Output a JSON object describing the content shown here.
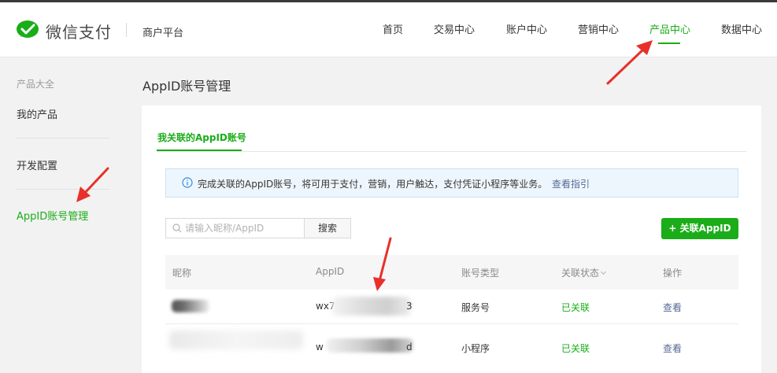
{
  "header": {
    "brand": "微信支付",
    "platform": "商户平台",
    "nav": [
      {
        "label": "首页",
        "active": false
      },
      {
        "label": "交易中心",
        "active": false
      },
      {
        "label": "账户中心",
        "active": false
      },
      {
        "label": "营销中心",
        "active": false
      },
      {
        "label": "产品中心",
        "active": true
      },
      {
        "label": "数据中心",
        "active": false
      }
    ]
  },
  "sidebar": {
    "title": "产品大全",
    "items": [
      {
        "label": "我的产品",
        "active": false
      },
      {
        "label": "开发配置",
        "active": false
      },
      {
        "label": "AppID账号管理",
        "active": true
      }
    ]
  },
  "page": {
    "title": "AppID账号管理",
    "tab": "我关联的AppID账号",
    "notice": {
      "icon": "info-icon",
      "text": "完成关联的AppID账号，将可用于支付，营销，用户触达，支付凭证小程序等业务。",
      "link": "查看指引"
    },
    "search": {
      "placeholder": "请输入昵称/AppID",
      "value": "",
      "button": "搜索"
    },
    "add_button": "+ 关联AppID"
  },
  "table": {
    "columns": [
      "昵称",
      "AppID",
      "账号类型",
      "关联状态",
      "操作"
    ],
    "rows": [
      {
        "nickname": "",
        "appid_start": "wx7",
        "appid_end": "3",
        "type": "服务号",
        "status": "已关联",
        "action": "查看"
      },
      {
        "nickname": "",
        "appid_start": "w",
        "appid_end": "d",
        "type": "小程序",
        "status": "已关联",
        "action": "查看"
      }
    ]
  },
  "colors": {
    "accent": "#1aad19",
    "link": "#576b95",
    "annotation": "#e8302a"
  }
}
